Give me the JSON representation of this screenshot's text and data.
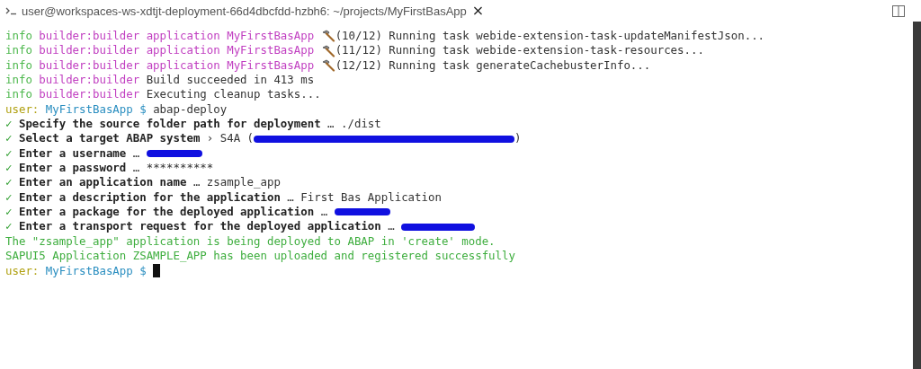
{
  "title_bar": {
    "title": "user@workspaces-ws-xdtjt-deployment-66d4dbcfdd-hzbh6: ~/projects/MyFirstBasApp",
    "close": "×"
  },
  "lines": [
    {
      "segments": [
        {
          "kind": "info",
          "text": "info"
        },
        {
          "kind": "tag",
          "text": " builder:builder application MyFirstBasApp "
        },
        {
          "kind": "hammer"
        },
        {
          "kind": "plain",
          "text": "(10/12) Running task webide-extension-task-updateManifestJson..."
        }
      ]
    },
    {
      "segments": [
        {
          "kind": "info",
          "text": "info"
        },
        {
          "kind": "tag",
          "text": " builder:builder application MyFirstBasApp "
        },
        {
          "kind": "hammer"
        },
        {
          "kind": "plain",
          "text": "(11/12) Running task webide-extension-task-resources..."
        }
      ]
    },
    {
      "segments": [
        {
          "kind": "info",
          "text": "info"
        },
        {
          "kind": "tag",
          "text": " builder:builder application MyFirstBasApp "
        },
        {
          "kind": "hammer"
        },
        {
          "kind": "plain",
          "text": "(12/12) Running task generateCachebusterInfo..."
        }
      ]
    },
    {
      "segments": [
        {
          "kind": "info",
          "text": "info"
        },
        {
          "kind": "tag",
          "text": " builder:builder "
        },
        {
          "kind": "plain",
          "text": "Build succeeded in 413 ms"
        }
      ]
    },
    {
      "segments": [
        {
          "kind": "info",
          "text": "info"
        },
        {
          "kind": "tag",
          "text": " builder:builder "
        },
        {
          "kind": "plain",
          "text": "Executing cleanup tasks..."
        }
      ]
    },
    {
      "segments": [
        {
          "kind": "user",
          "text": "user:"
        },
        {
          "kind": "path",
          "text": " MyFirstBasApp $ "
        },
        {
          "kind": "plain",
          "text": "abap-deploy"
        }
      ]
    },
    {
      "segments": [
        {
          "kind": "check",
          "text": "✓"
        },
        {
          "kind": "bold",
          "text": " Specify the source folder path for deployment "
        },
        {
          "kind": "plain",
          "text": "… ./dist"
        }
      ]
    },
    {
      "segments": [
        {
          "kind": "check",
          "text": "✓"
        },
        {
          "kind": "bold",
          "text": " Select a target ABAP system "
        },
        {
          "kind": "plain",
          "text": "› S4A ("
        },
        {
          "kind": "redaction-long"
        },
        {
          "kind": "plain",
          "text": ")"
        }
      ]
    },
    {
      "segments": [
        {
          "kind": "check",
          "text": "✓"
        },
        {
          "kind": "bold",
          "text": " Enter a username "
        },
        {
          "kind": "plain",
          "text": "… "
        },
        {
          "kind": "redaction-short"
        }
      ]
    },
    {
      "segments": [
        {
          "kind": "check",
          "text": "✓"
        },
        {
          "kind": "bold",
          "text": " Enter a password "
        },
        {
          "kind": "plain",
          "text": "… **********"
        }
      ]
    },
    {
      "segments": [
        {
          "kind": "check",
          "text": "✓"
        },
        {
          "kind": "bold",
          "text": " Enter an application name "
        },
        {
          "kind": "plain",
          "text": "… zsample_app"
        }
      ]
    },
    {
      "segments": [
        {
          "kind": "check",
          "text": "✓"
        },
        {
          "kind": "bold",
          "text": " Enter a description for the application "
        },
        {
          "kind": "plain",
          "text": "… First Bas Application"
        }
      ]
    },
    {
      "segments": [
        {
          "kind": "check",
          "text": "✓"
        },
        {
          "kind": "bold",
          "text": " Enter a package for the deployed application "
        },
        {
          "kind": "plain",
          "text": "… "
        },
        {
          "kind": "redaction-short"
        }
      ]
    },
    {
      "segments": [
        {
          "kind": "check",
          "text": "✓"
        },
        {
          "kind": "bold",
          "text": " Enter a transport request for the deployed application "
        },
        {
          "kind": "plain",
          "text": "… "
        },
        {
          "kind": "redaction-medium"
        }
      ]
    },
    {
      "segments": [
        {
          "kind": "success",
          "text": "The \"zsample_app\" application is being deployed to ABAP in 'create' mode."
        }
      ]
    },
    {
      "segments": [
        {
          "kind": "success",
          "text": "SAPUI5 Application ZSAMPLE_APP has been uploaded and registered successfully"
        }
      ]
    },
    {
      "segments": [
        {
          "kind": "user",
          "text": "user:"
        },
        {
          "kind": "path",
          "text": " MyFirstBasApp $ "
        },
        {
          "kind": "cursor"
        }
      ]
    }
  ]
}
